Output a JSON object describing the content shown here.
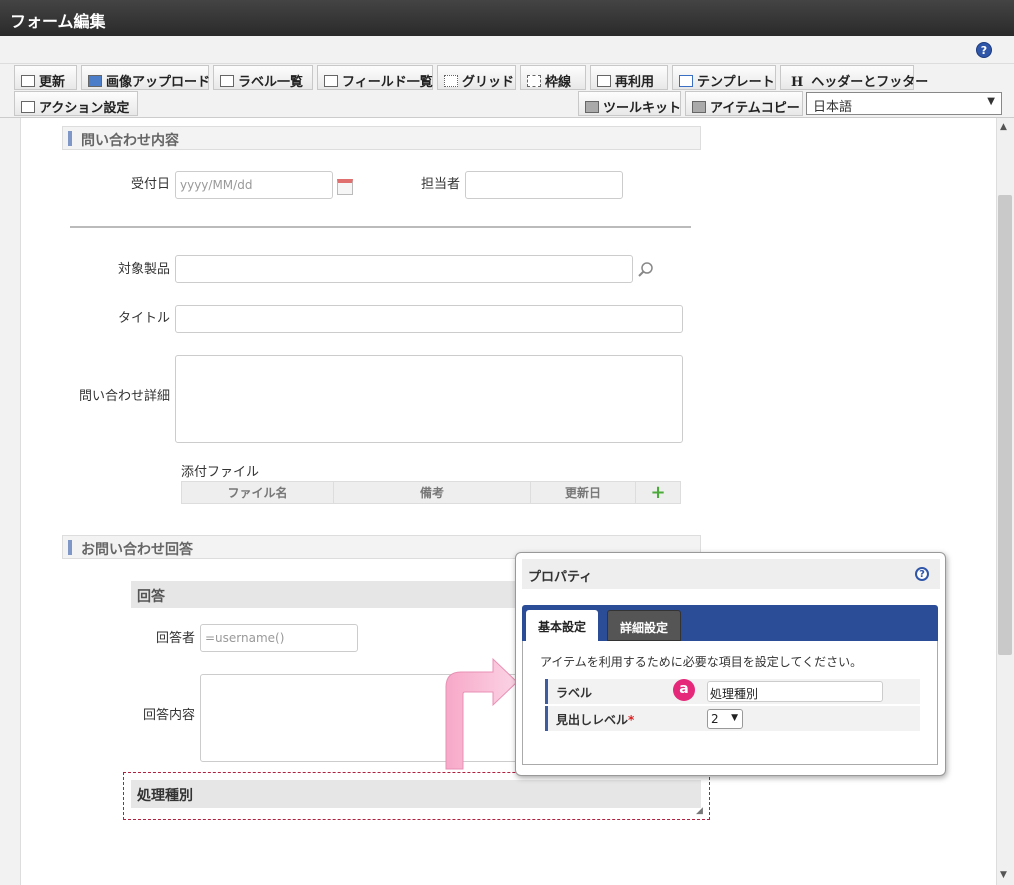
{
  "window": {
    "title": "フォーム編集"
  },
  "help": {
    "icon_char": "?"
  },
  "toolbar": {
    "row1": [
      "更新",
      "画像アップロード",
      "ラベル一覧",
      "フィールド一覧",
      "グリッド",
      "枠線",
      "再利用",
      "テンプレート",
      "ヘッダーとフッター"
    ],
    "row2_left": "アクション設定",
    "row2_right": [
      "ツールキット",
      "アイテムコピー"
    ],
    "language": "日本語",
    "header_icon_char": "H"
  },
  "form": {
    "section1": "問い合わせ内容",
    "received_date_label": "受付日",
    "received_date_placeholder": "yyyy/MM/dd",
    "assignee_label": "担当者",
    "product_label": "対象製品",
    "title_label": "タイトル",
    "details_label": "問い合わせ詳細",
    "attachments_label": "添付ファイル",
    "attach_columns": [
      "ファイル名",
      "備考",
      "更新日"
    ],
    "section2": "お問い合わせ回答",
    "answer_subhead": "回答",
    "responder_label": "回答者",
    "responder_value": "=username()",
    "answer_content_label": "回答内容",
    "selected_item_label": "処理種別"
  },
  "properties": {
    "title": "プロパティ",
    "tabs": [
      "基本設定",
      "詳細設定"
    ],
    "description": "アイテムを利用するために必要な項目を設定してください。",
    "rows": [
      {
        "key": "ラベル",
        "value": "処理種別"
      },
      {
        "key": "見出しレベル",
        "required_mark": "*",
        "value": "2"
      }
    ],
    "badge": "a"
  },
  "colors": {
    "accent": "#2b4c97",
    "badge": "#e5287a",
    "arrow": "#f7a8c8"
  }
}
